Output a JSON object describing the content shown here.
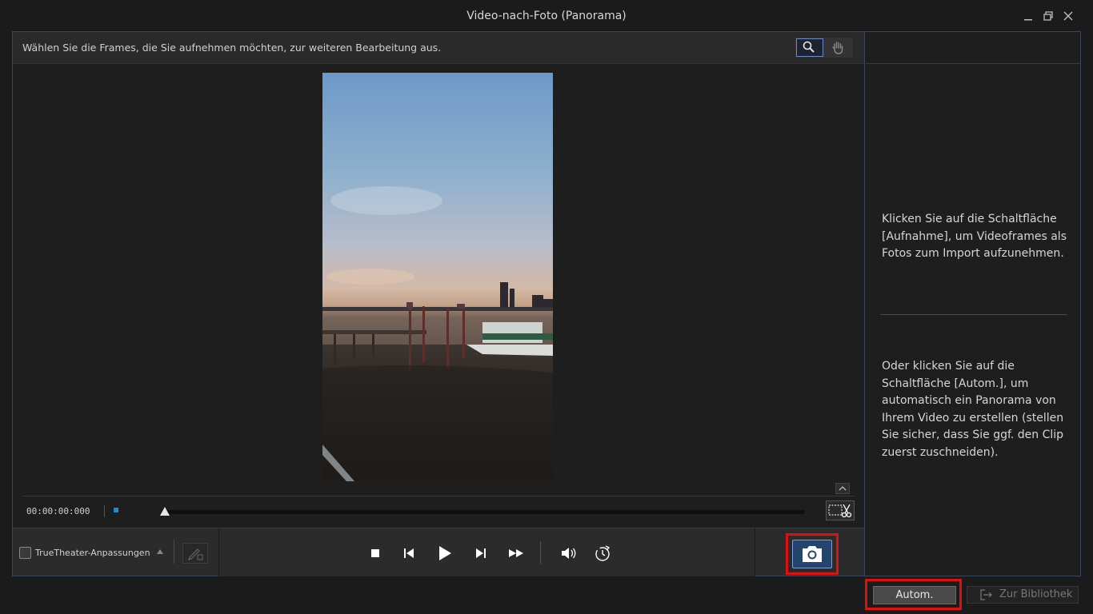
{
  "window": {
    "title": "Video-nach-Foto (Panorama)",
    "minimize_icon": "minimize-icon",
    "restore_icon": "restore-icon",
    "close_icon": "close-icon"
  },
  "info_bar": {
    "instruction": "Wählen Sie die Frames, die Sie aufnehmen möchten, zur weiteren Bearbeitung aus.",
    "tools": [
      "zoom-icon",
      "hand-icon"
    ]
  },
  "timeline": {
    "timecode": "00:00:00:000"
  },
  "controls": {
    "truetheater_label": "TrueTheater-Anpassungen",
    "truetheater_checked": false,
    "player_buttons": [
      "stop-icon",
      "previous-frame-icon",
      "play-icon",
      "next-frame-icon",
      "fast-forward-icon",
      "volume-icon",
      "speed-icon"
    ],
    "snapshot_icon": "camera-icon"
  },
  "hints": {
    "first": "Klicken Sie auf die Schaltfläche [Aufnahme], um Videoframes als Fotos zum Import aufzunehmen.",
    "second": "Oder klicken Sie auf die Schaltfläche [Autom.], um automatisch ein Panorama von Ihrem Video zu erstellen (stellen Sie sicher, dass Sie ggf. den Clip zuerst zuschneiden)."
  },
  "footer": {
    "autom_label": "Autom.",
    "library_label": "Zur Bibliothek"
  },
  "colors": {
    "highlight": "#e01010",
    "accent_blue": "#25456e",
    "marker_blue": "#1e8ad6"
  }
}
